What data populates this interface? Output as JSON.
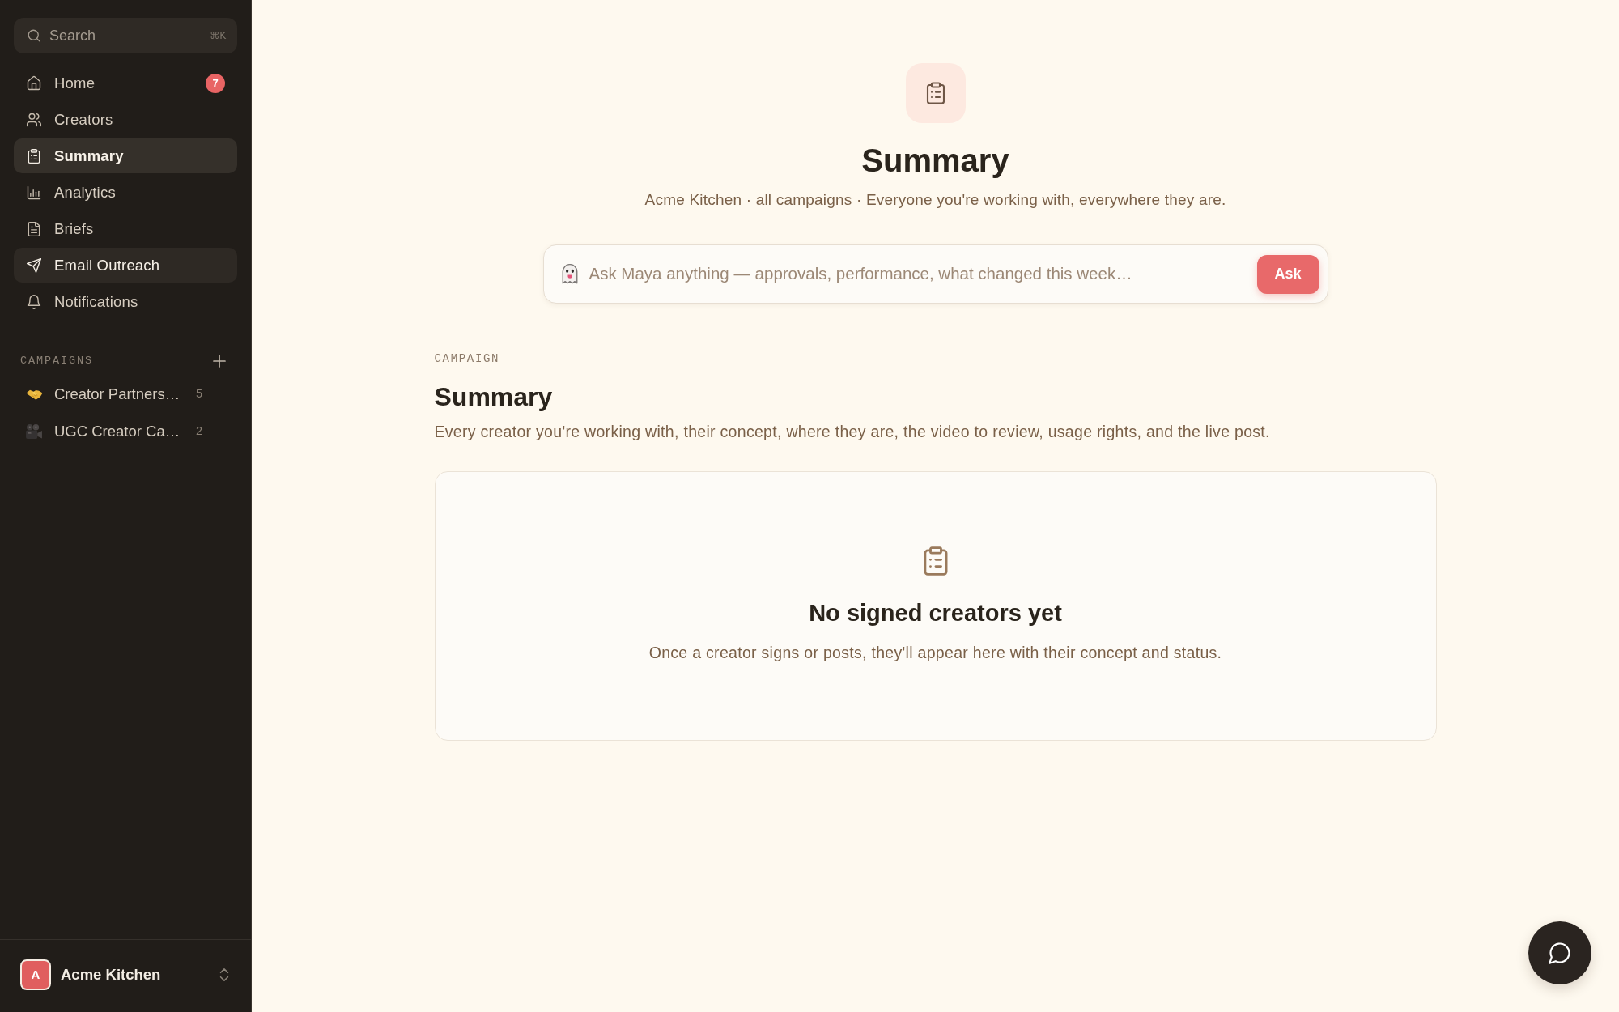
{
  "sidebar": {
    "search": {
      "placeholder": "Search",
      "shortcut": "⌘K"
    },
    "nav_items": [
      {
        "label": "Home",
        "badge": "7",
        "selected": false,
        "highlighted": false
      },
      {
        "label": "Creators",
        "selected": false,
        "highlighted": false
      },
      {
        "label": "Summary",
        "selected": true,
        "highlighted": false
      },
      {
        "label": "Analytics",
        "selected": false,
        "highlighted": false
      },
      {
        "label": "Briefs",
        "selected": false,
        "highlighted": false
      },
      {
        "label": "Email Outreach",
        "selected": false,
        "highlighted": true
      },
      {
        "label": "Notifications",
        "selected": false,
        "highlighted": false
      }
    ],
    "campaigns": {
      "heading": "CAMPAIGNS",
      "items": [
        {
          "label": "Creator Partners…",
          "count": "5"
        },
        {
          "label": "UGC Creator Ca…",
          "count": "2"
        }
      ]
    },
    "workspace": {
      "avatar": "A",
      "name": "Acme Kitchen"
    }
  },
  "main": {
    "header": {
      "title": "Summary",
      "subtitle": "Acme Kitchen · all campaigns · Everyone you're working with, everywhere they are."
    },
    "ask": {
      "placeholder": "Ask Maya anything — approvals, performance, what changed this week…",
      "button": "Ask"
    },
    "section": {
      "eyebrow": "CAMPAIGN",
      "title": "Summary",
      "description": "Every creator you're working with, their concept, where they are, the video to review, usage rights, and the live post."
    },
    "empty_state": {
      "title": "No signed creators yet",
      "text": "Once a creator signs or posts, they'll appear here with their concept and status."
    }
  }
}
